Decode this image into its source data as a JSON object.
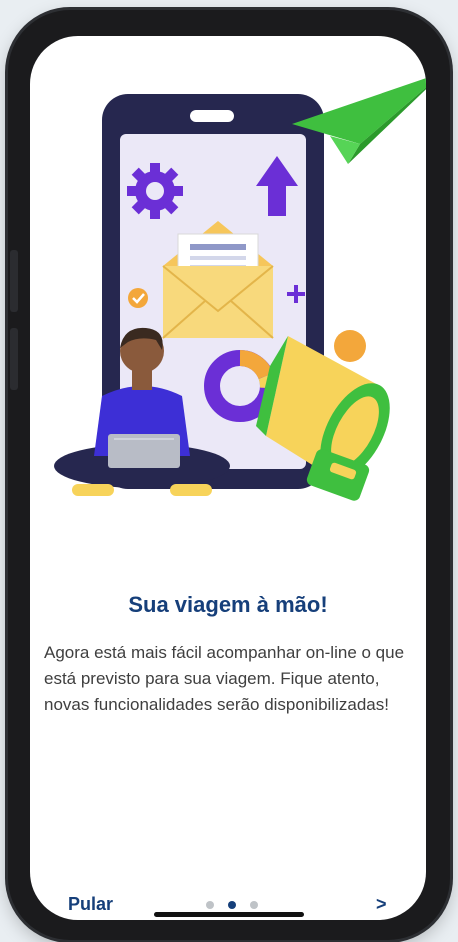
{
  "onboarding": {
    "title": "Sua viagem à mão!",
    "description": "Agora está mais fácil acompanhar on-line o que está previsto para sua viagem. Fique atento, novas funcionalidades serão disponibilizadas!",
    "skip_label": "Pular",
    "next_label": ">",
    "pages_total": 3,
    "current_page": 2
  },
  "illustration": {
    "icons": [
      "gear-icon",
      "up-arrow-icon",
      "envelope-icon",
      "check-icon",
      "plus-icon",
      "donut-chart-icon",
      "paper-plane-icon",
      "megaphone-icon",
      "person-with-laptop"
    ]
  },
  "colors": {
    "primary_text": "#163f7a",
    "body_text": "#3f3f3f",
    "dot_active": "#163f7a",
    "dot_inactive": "#bfc3c7",
    "purple": "#6b2fd6",
    "green": "#3fbf3f",
    "yellow": "#f7d35a",
    "navy": "#26274f"
  }
}
